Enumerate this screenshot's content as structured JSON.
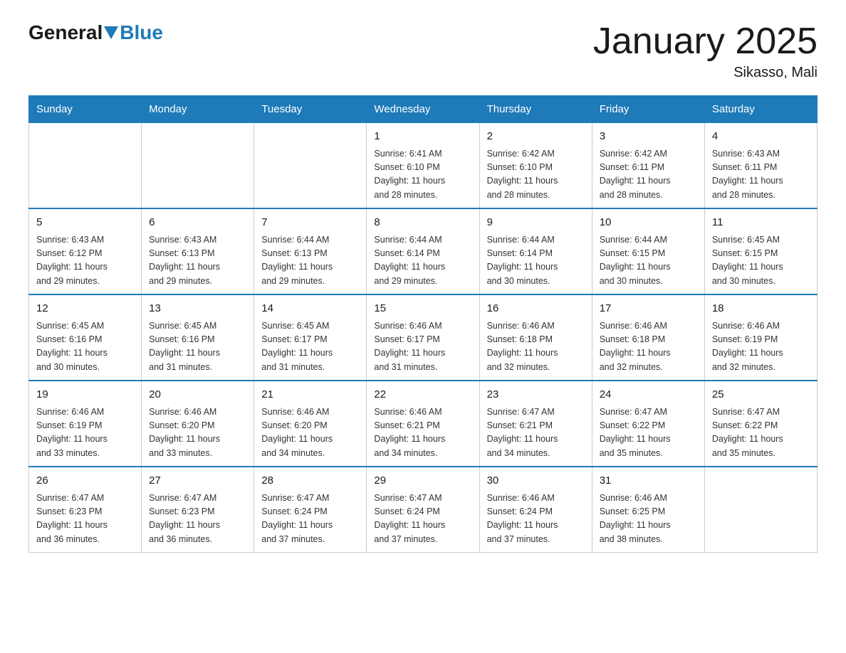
{
  "header": {
    "logo_general": "General",
    "logo_blue": "Blue",
    "title": "January 2025",
    "location": "Sikasso, Mali"
  },
  "weekdays": [
    "Sunday",
    "Monday",
    "Tuesday",
    "Wednesday",
    "Thursday",
    "Friday",
    "Saturday"
  ],
  "weeks": [
    {
      "days": [
        {
          "number": "",
          "info": ""
        },
        {
          "number": "",
          "info": ""
        },
        {
          "number": "",
          "info": ""
        },
        {
          "number": "1",
          "info": "Sunrise: 6:41 AM\nSunset: 6:10 PM\nDaylight: 11 hours\nand 28 minutes."
        },
        {
          "number": "2",
          "info": "Sunrise: 6:42 AM\nSunset: 6:10 PM\nDaylight: 11 hours\nand 28 minutes."
        },
        {
          "number": "3",
          "info": "Sunrise: 6:42 AM\nSunset: 6:11 PM\nDaylight: 11 hours\nand 28 minutes."
        },
        {
          "number": "4",
          "info": "Sunrise: 6:43 AM\nSunset: 6:11 PM\nDaylight: 11 hours\nand 28 minutes."
        }
      ]
    },
    {
      "days": [
        {
          "number": "5",
          "info": "Sunrise: 6:43 AM\nSunset: 6:12 PM\nDaylight: 11 hours\nand 29 minutes."
        },
        {
          "number": "6",
          "info": "Sunrise: 6:43 AM\nSunset: 6:13 PM\nDaylight: 11 hours\nand 29 minutes."
        },
        {
          "number": "7",
          "info": "Sunrise: 6:44 AM\nSunset: 6:13 PM\nDaylight: 11 hours\nand 29 minutes."
        },
        {
          "number": "8",
          "info": "Sunrise: 6:44 AM\nSunset: 6:14 PM\nDaylight: 11 hours\nand 29 minutes."
        },
        {
          "number": "9",
          "info": "Sunrise: 6:44 AM\nSunset: 6:14 PM\nDaylight: 11 hours\nand 30 minutes."
        },
        {
          "number": "10",
          "info": "Sunrise: 6:44 AM\nSunset: 6:15 PM\nDaylight: 11 hours\nand 30 minutes."
        },
        {
          "number": "11",
          "info": "Sunrise: 6:45 AM\nSunset: 6:15 PM\nDaylight: 11 hours\nand 30 minutes."
        }
      ]
    },
    {
      "days": [
        {
          "number": "12",
          "info": "Sunrise: 6:45 AM\nSunset: 6:16 PM\nDaylight: 11 hours\nand 30 minutes."
        },
        {
          "number": "13",
          "info": "Sunrise: 6:45 AM\nSunset: 6:16 PM\nDaylight: 11 hours\nand 31 minutes."
        },
        {
          "number": "14",
          "info": "Sunrise: 6:45 AM\nSunset: 6:17 PM\nDaylight: 11 hours\nand 31 minutes."
        },
        {
          "number": "15",
          "info": "Sunrise: 6:46 AM\nSunset: 6:17 PM\nDaylight: 11 hours\nand 31 minutes."
        },
        {
          "number": "16",
          "info": "Sunrise: 6:46 AM\nSunset: 6:18 PM\nDaylight: 11 hours\nand 32 minutes."
        },
        {
          "number": "17",
          "info": "Sunrise: 6:46 AM\nSunset: 6:18 PM\nDaylight: 11 hours\nand 32 minutes."
        },
        {
          "number": "18",
          "info": "Sunrise: 6:46 AM\nSunset: 6:19 PM\nDaylight: 11 hours\nand 32 minutes."
        }
      ]
    },
    {
      "days": [
        {
          "number": "19",
          "info": "Sunrise: 6:46 AM\nSunset: 6:19 PM\nDaylight: 11 hours\nand 33 minutes."
        },
        {
          "number": "20",
          "info": "Sunrise: 6:46 AM\nSunset: 6:20 PM\nDaylight: 11 hours\nand 33 minutes."
        },
        {
          "number": "21",
          "info": "Sunrise: 6:46 AM\nSunset: 6:20 PM\nDaylight: 11 hours\nand 34 minutes."
        },
        {
          "number": "22",
          "info": "Sunrise: 6:46 AM\nSunset: 6:21 PM\nDaylight: 11 hours\nand 34 minutes."
        },
        {
          "number": "23",
          "info": "Sunrise: 6:47 AM\nSunset: 6:21 PM\nDaylight: 11 hours\nand 34 minutes."
        },
        {
          "number": "24",
          "info": "Sunrise: 6:47 AM\nSunset: 6:22 PM\nDaylight: 11 hours\nand 35 minutes."
        },
        {
          "number": "25",
          "info": "Sunrise: 6:47 AM\nSunset: 6:22 PM\nDaylight: 11 hours\nand 35 minutes."
        }
      ]
    },
    {
      "days": [
        {
          "number": "26",
          "info": "Sunrise: 6:47 AM\nSunset: 6:23 PM\nDaylight: 11 hours\nand 36 minutes."
        },
        {
          "number": "27",
          "info": "Sunrise: 6:47 AM\nSunset: 6:23 PM\nDaylight: 11 hours\nand 36 minutes."
        },
        {
          "number": "28",
          "info": "Sunrise: 6:47 AM\nSunset: 6:24 PM\nDaylight: 11 hours\nand 37 minutes."
        },
        {
          "number": "29",
          "info": "Sunrise: 6:47 AM\nSunset: 6:24 PM\nDaylight: 11 hours\nand 37 minutes."
        },
        {
          "number": "30",
          "info": "Sunrise: 6:46 AM\nSunset: 6:24 PM\nDaylight: 11 hours\nand 37 minutes."
        },
        {
          "number": "31",
          "info": "Sunrise: 6:46 AM\nSunset: 6:25 PM\nDaylight: 11 hours\nand 38 minutes."
        },
        {
          "number": "",
          "info": ""
        }
      ]
    }
  ]
}
